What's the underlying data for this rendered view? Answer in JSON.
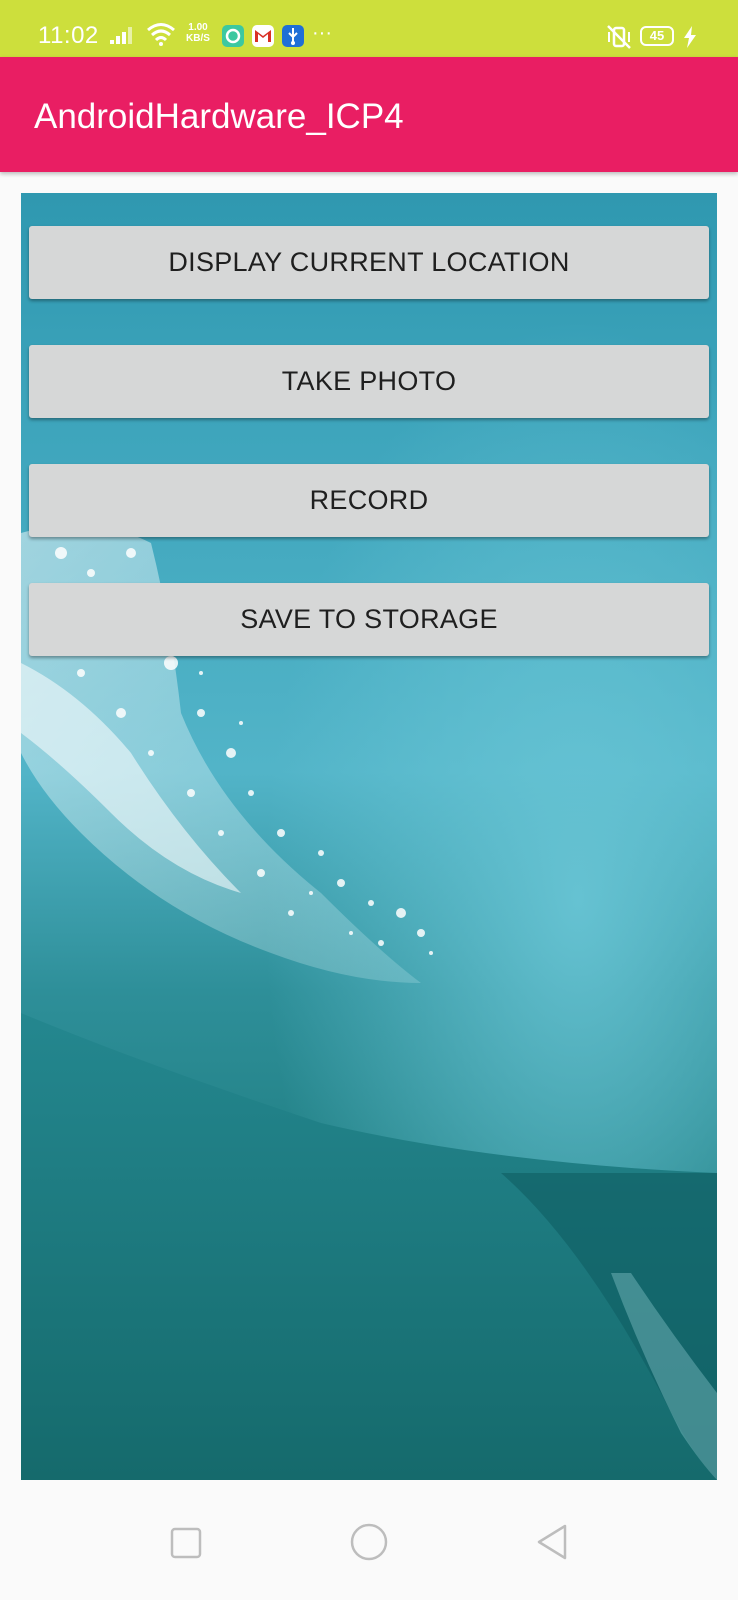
{
  "status_bar": {
    "time": "11:02",
    "net_speed_value": "1.00",
    "net_speed_unit": "KB/S",
    "battery": "45",
    "icons": [
      "signal-icon",
      "wifi-icon",
      "green-app-icon",
      "gmail-icon",
      "usb-icon",
      "more-icon",
      "vibrate-icon",
      "battery-icon",
      "charging-icon"
    ],
    "more_glyph": "···",
    "gmail_glyph": "M",
    "usb_glyph": "⚲"
  },
  "app_bar": {
    "title": "AndroidHardware_ICP4"
  },
  "buttons": {
    "display_location": "DISPLAY CURRENT LOCATION",
    "take_photo": "TAKE PHOTO",
    "record": "RECORD",
    "save_storage": "SAVE TO STORAGE"
  },
  "colors": {
    "status_bar": "#cddf3c",
    "app_bar": "#e91e63",
    "button": "#d6d7d7",
    "water": "#2f98b0"
  },
  "nav_bar": {
    "icons": [
      "recent-apps-icon",
      "home-icon",
      "back-icon"
    ]
  }
}
